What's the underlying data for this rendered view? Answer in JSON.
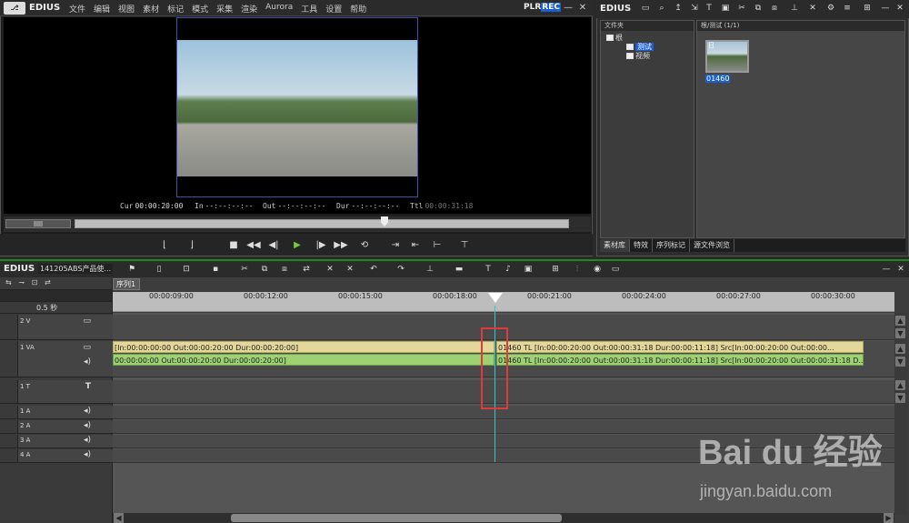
{
  "app": {
    "brand": "EDIUS"
  },
  "menu": [
    "文件",
    "编辑",
    "视图",
    "素材",
    "标记",
    "模式",
    "采集",
    "渲染",
    "Aurora",
    "工具",
    "设置",
    "帮助"
  ],
  "player": {
    "plr": "PLR",
    "rec": "REC",
    "cur_label": "Cur",
    "cur": "00:00:20:00",
    "in_label": "In",
    "in": "--:--:--:--",
    "out_label": "Out",
    "out": "--:--:--:--",
    "dur_label": "Dur",
    "dur": "--:--:--:--",
    "ttl_label": "Ttl",
    "ttl": "00:00:31:18"
  },
  "bin": {
    "brand": "EDIUS",
    "folder_header": "文件夹",
    "clip_header": "根/测试 (1/1)",
    "tree": {
      "root": "根",
      "test": "测试",
      "video": "视频"
    },
    "clip_name": "01460",
    "clip_flag": "日",
    "tabs": [
      "素材库",
      "特效",
      "序列标记",
      "源文件浏览"
    ]
  },
  "timeline": {
    "brand": "EDIUS",
    "project": "141205ABS产品使...",
    "sequence": "序列1",
    "zoom": "0.5 秒",
    "ticks": [
      "00:00:09:00",
      "00:00:12:00",
      "00:00:15:00",
      "00:00:18:00",
      "00:00:21:00",
      "00:00:24:00",
      "00:00:27:00",
      "00:00:30:00"
    ],
    "tracks": {
      "v2": "2 V",
      "va1": "1 VA",
      "t1": "1 T",
      "a1": "1 A",
      "a2": "2 A",
      "a3": "3 A",
      "a4": "4 A"
    },
    "clips": {
      "v_left": "[In:00:00:00:00 Out:00:00:20:00 Dur:00:00:20:00]",
      "a_left": "00:00:00:00 Out:00:00:20:00 Dur:00:00:20:00]",
      "v_right": "01460  TL [In:00:00:20:00 Out:00:00:31:18 Dur:00:00:11:18]  Src[In:00:00:20:00 Out:00:00...",
      "a_right": "01460  TL [In:00:00:20:00 Out:00:00:31:18 Dur:00:00:11:18]  Src[In:00:00:20:00 Out:00:00:31:18 D..."
    }
  },
  "watermark": {
    "logo": "Bai du 经验",
    "url": "jingyan.baidu.com"
  },
  "colors": {
    "accent": "#1a5fd0",
    "cursor": "#37c6c6",
    "highlight": "#e03a3a",
    "video_clip": "#e3d89a",
    "audio_clip": "#9ed074"
  }
}
